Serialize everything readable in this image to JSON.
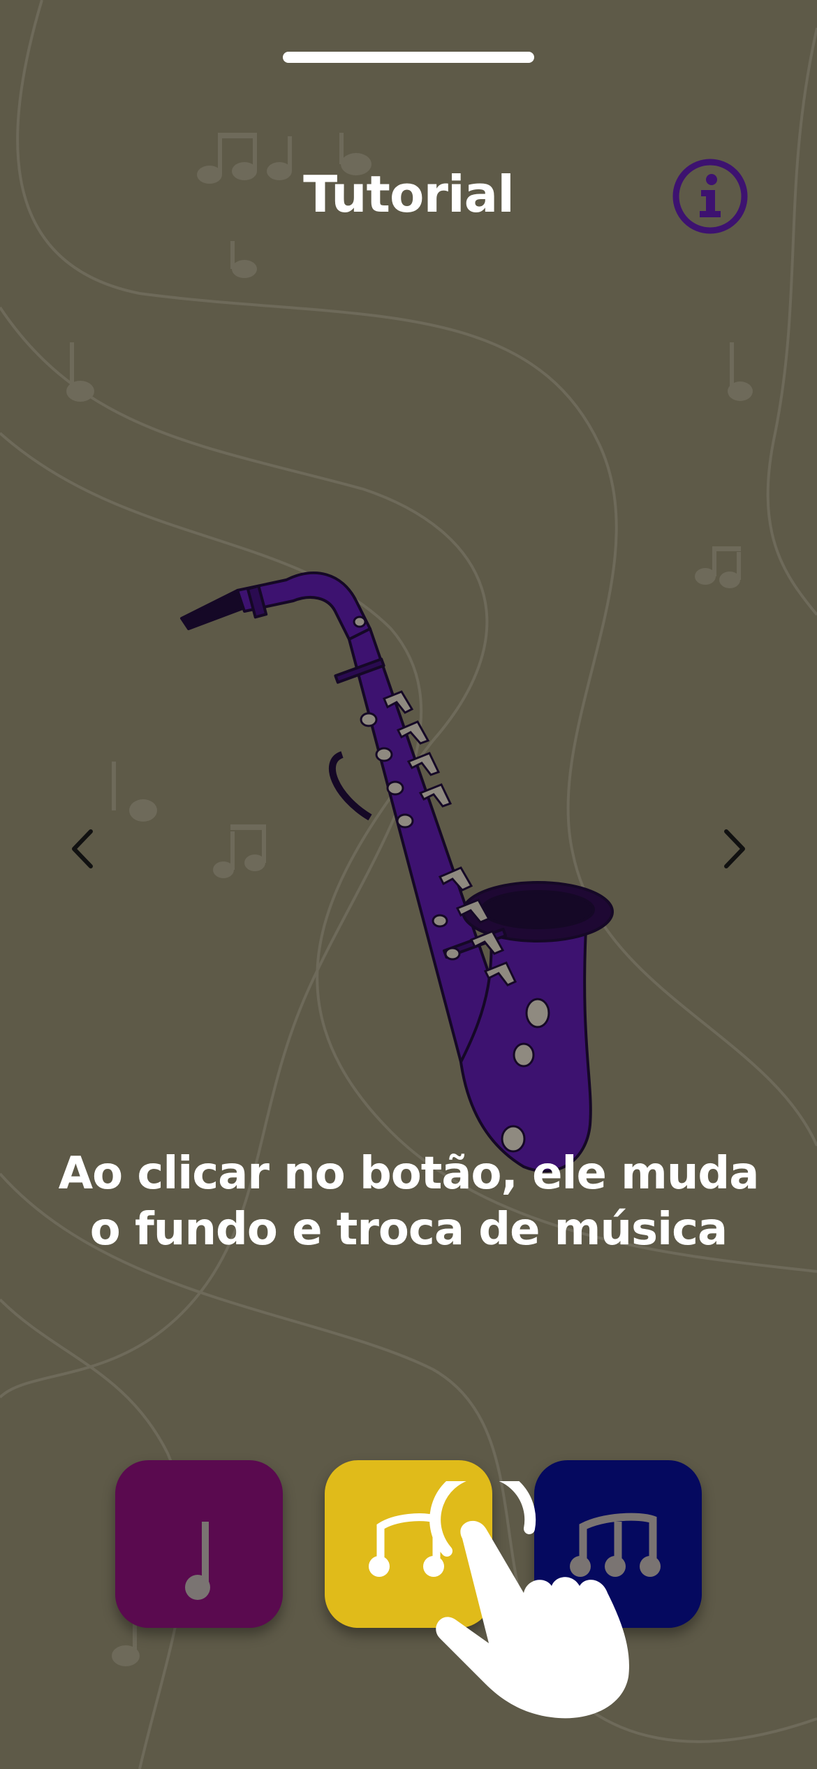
{
  "header": {
    "title": "Tutorial",
    "info_icon": "info-icon"
  },
  "carousel": {
    "prev_icon": "chevron-left-icon",
    "next_icon": "chevron-right-icon",
    "illustration": "saxophone-illustration",
    "caption_line1": "Ao clicar no botão, ele muda",
    "caption_line2": "o fundo e troca de música"
  },
  "music_buttons": [
    {
      "icon": "single-note-icon",
      "color": "#5a0a4f"
    },
    {
      "icon": "double-note-icon",
      "color": "#e0bb1a"
    },
    {
      "icon": "triple-note-icon",
      "color": "#05095f"
    }
  ],
  "gesture": {
    "icon": "tap-hand-icon"
  },
  "colors": {
    "background": "#5e5a48",
    "accent_purple": "#3d1270",
    "text": "#ffffff"
  }
}
